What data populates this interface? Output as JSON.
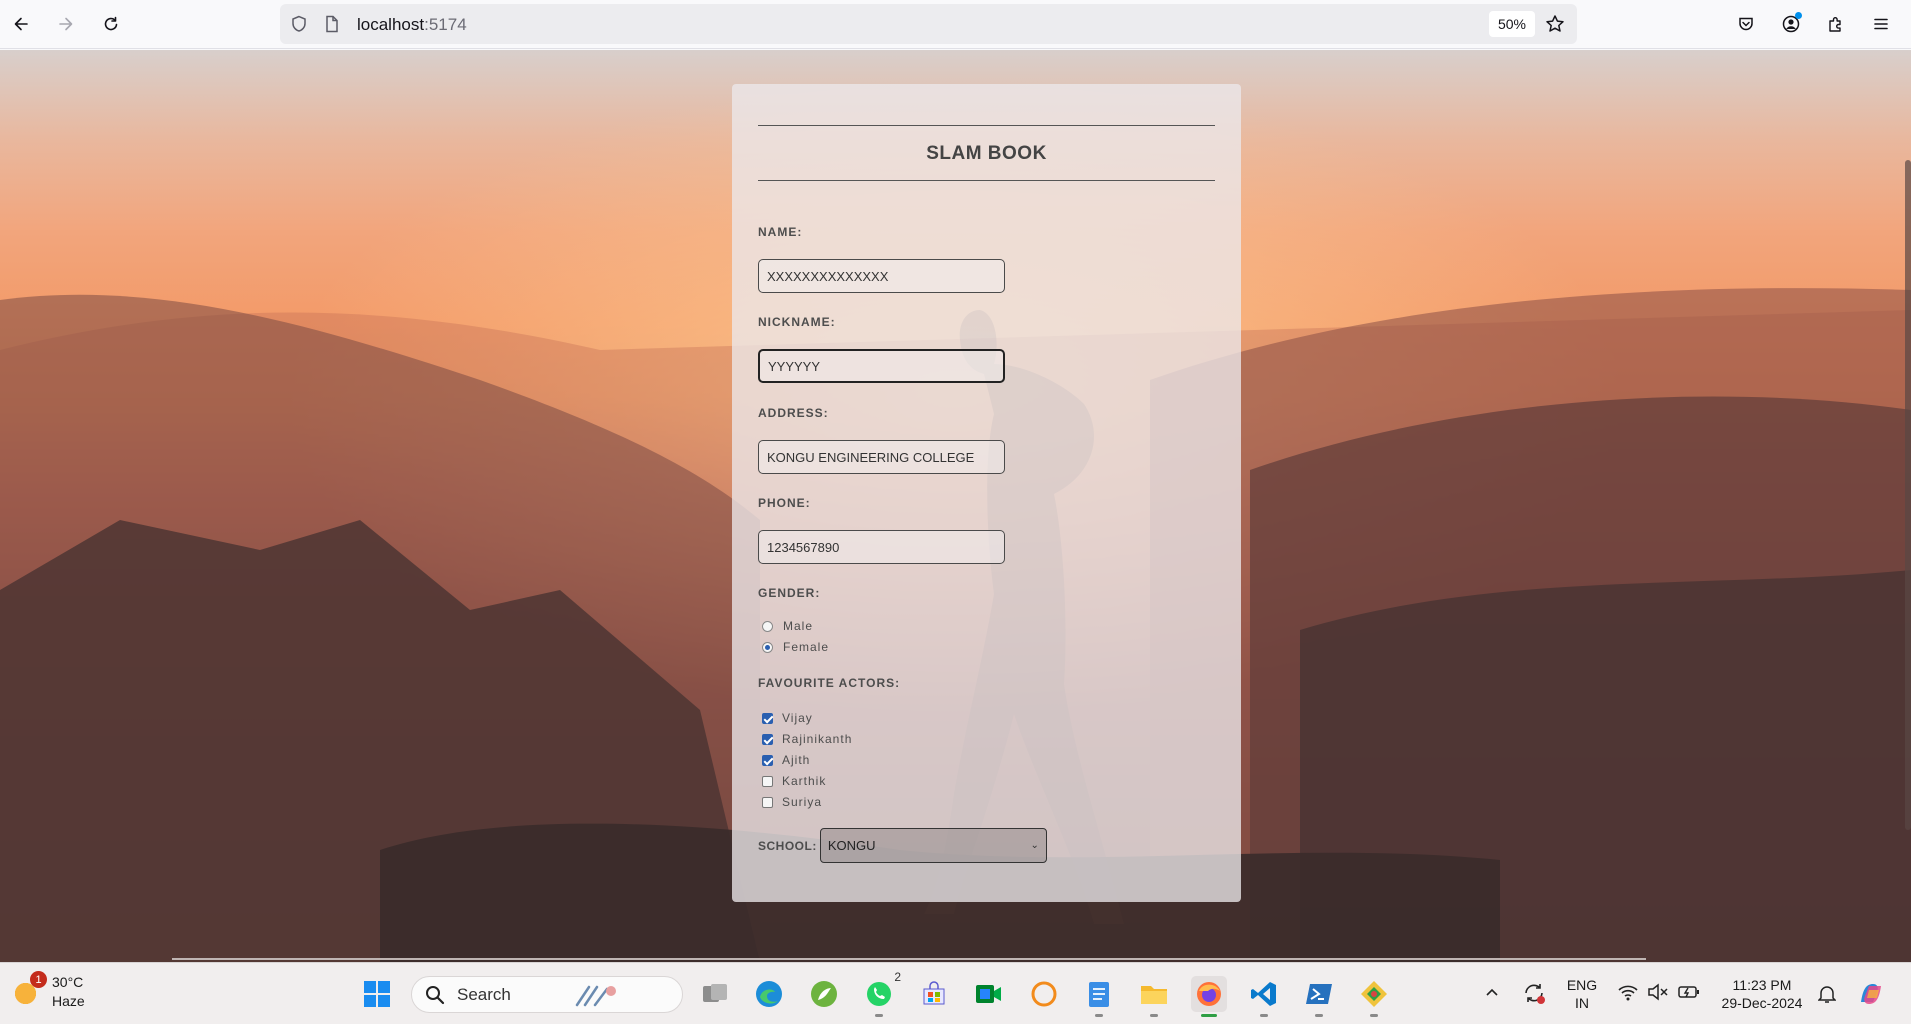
{
  "browser": {
    "url_host": "localhost",
    "url_port": ":5174",
    "zoom": "50%"
  },
  "form": {
    "title": "SLAM BOOK",
    "name_label": "NAME:",
    "name_value": "XXXXXXXXXXXXXX",
    "nickname_label": "NICKNAME:",
    "nickname_value": "YYYYYY",
    "address_label": "ADDRESS:",
    "address_value": "KONGU ENGINEERING COLLEGE",
    "phone_label": "PHONE:",
    "phone_value": "1234567890",
    "gender_label": "GENDER:",
    "gender_options": [
      {
        "label": "Male",
        "checked": false
      },
      {
        "label": "Female",
        "checked": true
      }
    ],
    "actors_label": "FAVOURITE ACTORS:",
    "actors": [
      {
        "label": "Vijay",
        "checked": true
      },
      {
        "label": "Rajinikanth",
        "checked": true
      },
      {
        "label": "Ajith",
        "checked": true
      },
      {
        "label": "Karthik",
        "checked": false
      },
      {
        "label": "Suriya",
        "checked": false
      }
    ],
    "school_label": "SCHOOL:",
    "school_value": "KONGU"
  },
  "taskbar": {
    "weather_temp": "30°C",
    "weather_desc": "Haze",
    "weather_badge": "1",
    "search_label": "Search",
    "whatsapp_badge": "2",
    "lang_line1": "ENG",
    "lang_line2": "IN",
    "time": "11:23 PM",
    "date": "29-Dec-2024"
  }
}
